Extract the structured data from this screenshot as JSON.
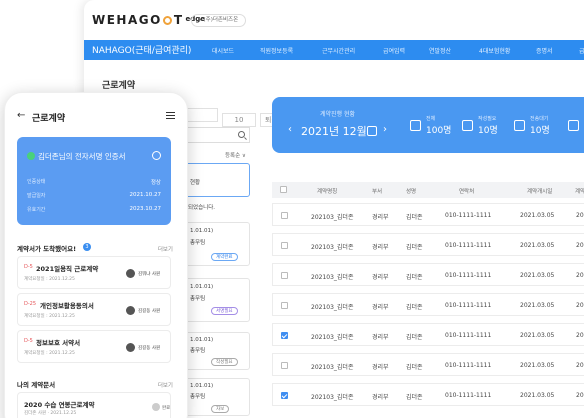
{
  "desktop": {
    "logo": "WEHAGO",
    "logo_suffix": "T",
    "logo_edge": "edge",
    "company": "▸ (주)더존비즈온",
    "nav_title": "NAHAGO(근태/급여관리)",
    "nav_items": [
      "대시보드",
      "직원정보등록",
      "근무시간관리",
      "급여입력",
      "연말정산",
      "4대보험현황",
      "증명서",
      "급"
    ],
    "page_title": "근로계약",
    "list_tabs": [
      "",
      "10",
      "퇴직 10"
    ],
    "sort_label": "등록순 ∨",
    "card_fragments": {
      "c1": "현황",
      "done": "되었습니다.",
      "c3a": "1.01.01)",
      "c3b": "총무팀",
      "c3tag": "계약완료",
      "c4a": "1.01.01)",
      "c4b": "총무팀",
      "c4tag": "서명필요",
      "c5a": "1.01.01)",
      "c5b": "총무팀",
      "c5tag": "작성필요",
      "c6a": "1.01.01)",
      "c6b": "총무팀",
      "c6tag": "자보"
    },
    "calendar": {
      "label": "계약진행 현황",
      "prev": "‹",
      "month": "2021년 12월",
      "next": "›",
      "stats": [
        {
          "label": "전체",
          "value": "100명"
        },
        {
          "label": "작성필요",
          "value": "10명"
        },
        {
          "label": "전송대기",
          "value": "10명"
        }
      ]
    },
    "table": {
      "headers": [
        "계약명칭",
        "부서",
        "성명",
        "연락처",
        "계약개시일",
        "계약종"
      ],
      "rows": [
        {
          "checked": false,
          "name": "202103_김더존",
          "dept": "경리부",
          "person": "김더존",
          "phone": "010-1111-1111",
          "start": "2021.03.05",
          "end": "2021.0"
        },
        {
          "checked": false,
          "name": "202103_김더존",
          "dept": "경리부",
          "person": "김더존",
          "phone": "010-1111-1111",
          "start": "2021.03.05",
          "end": "2021.0"
        },
        {
          "checked": false,
          "name": "202103_김더존",
          "dept": "경리부",
          "person": "김더존",
          "phone": "010-1111-1111",
          "start": "2021.03.05",
          "end": "2021.0"
        },
        {
          "checked": false,
          "name": "202103_김더존",
          "dept": "경리부",
          "person": "김더존",
          "phone": "010-1111-1111",
          "start": "2021.03.05",
          "end": "2021.0"
        },
        {
          "checked": true,
          "name": "202103_김더존",
          "dept": "경리부",
          "person": "김더존",
          "phone": "010-1111-1111",
          "start": "2021.03.05",
          "end": "2021.0"
        },
        {
          "checked": false,
          "name": "202103_김더존",
          "dept": "경리부",
          "person": "김더존",
          "phone": "010-1111-1111",
          "start": "2021.03.05",
          "end": "2021.0"
        },
        {
          "checked": true,
          "name": "202103_김더존",
          "dept": "경리부",
          "person": "김더존",
          "phone": "010-1111-1111",
          "start": "2021.03.05",
          "end": "2021.0"
        }
      ]
    }
  },
  "phone": {
    "back": "←",
    "title": "근로계약",
    "cert": {
      "title": "김더존님의 전자서명 인증서",
      "rows": [
        {
          "key": "인증상태",
          "value": "정상"
        },
        {
          "key": "발급일자",
          "value": "2021.10.27"
        },
        {
          "key": "유효기간",
          "value": "2023.10.27"
        }
      ]
    },
    "arrived_title": "계약서가 도착했어요!",
    "arrived_badge": "3",
    "more": "더보기",
    "arrived": [
      {
        "prefix": "D-5",
        "name": "2021일용직 근로계약",
        "sub": "계약요청일 : 2021.12.25",
        "assignee": "김뭐냐 사원"
      },
      {
        "prefix": "D-25",
        "name": "개인정보활용동의서",
        "sub": "계약요청일 : 2021.12.25",
        "assignee": "김길동 사원"
      },
      {
        "prefix": "D-5",
        "name": "정보보호 서약서",
        "sub": "계약요청일 : 2021.12.25",
        "assignee": "김길동 사원"
      }
    ],
    "mine_title": "나의 계약문서",
    "mine_more": "더보기",
    "mine": {
      "name": "2020 수습 연봉근로계약",
      "sub": "김더존 사원 · 2021.12.25",
      "status": "완료"
    }
  }
}
